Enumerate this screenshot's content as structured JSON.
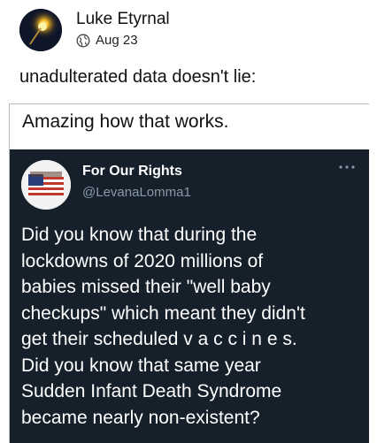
{
  "post": {
    "author": "Luke Etyrnal",
    "date": "Aug 23",
    "privacy_icon": "globe-icon",
    "text": "unadulterated data doesn't lie:"
  },
  "quote": {
    "caption": "Amazing how that works.",
    "tweet": {
      "name": "For Our Rights",
      "handle": "@LevanaLomma1",
      "lines": [
        "Did you know that during the",
        "lockdowns of 2020 millions of",
        "babies missed their \"well baby",
        "checkups\" which meant they didn't",
        "get their scheduled v a c c i n e s.",
        "Did you know that same year",
        "Sudden Infant Death Syndrome",
        "became nearly non-existent?"
      ]
    }
  },
  "colors": {
    "tweet_background": "#15202b",
    "handle_gray": "#8899a6",
    "text_dark": "#111111"
  }
}
